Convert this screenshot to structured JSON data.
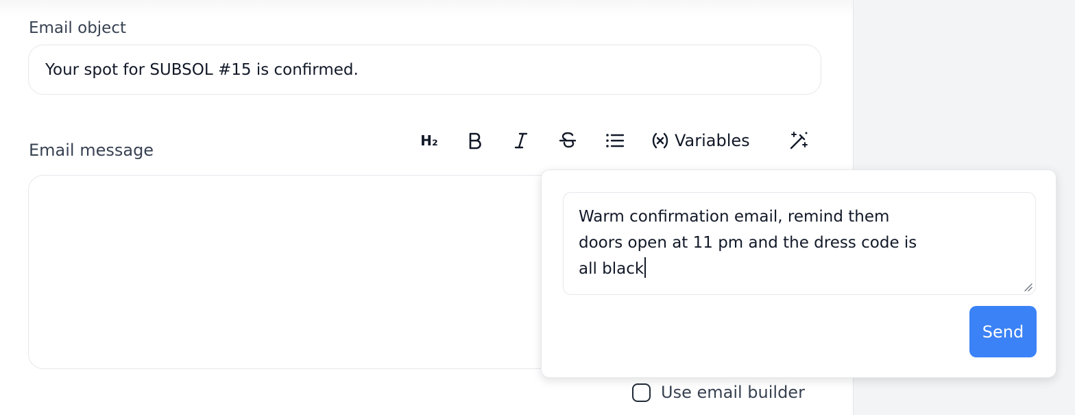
{
  "email_object": {
    "label": "Email object",
    "value": "Your spot for SUBSOL #15 is confirmed."
  },
  "email_message": {
    "label": "Email message",
    "value": ""
  },
  "toolbar": {
    "heading_label": "H₂",
    "variables_label": "Variables",
    "icons": [
      "heading-icon",
      "bold-icon",
      "italic-icon",
      "strikethrough-icon",
      "list-icon",
      "variables-icon",
      "magic-wand-icon"
    ]
  },
  "ai_prompt": {
    "lines": [
      "Warm confirmation email, remind them",
      "doors open at 11 pm and the dress code is",
      "all black"
    ],
    "send_label": "Send"
  },
  "email_builder": {
    "label": "Use email builder",
    "checked": false
  },
  "colors": {
    "accent": "#3b82f6",
    "label_text": "#374151",
    "border": "#e5e7eb",
    "side_panel": "#f3f4f6"
  }
}
